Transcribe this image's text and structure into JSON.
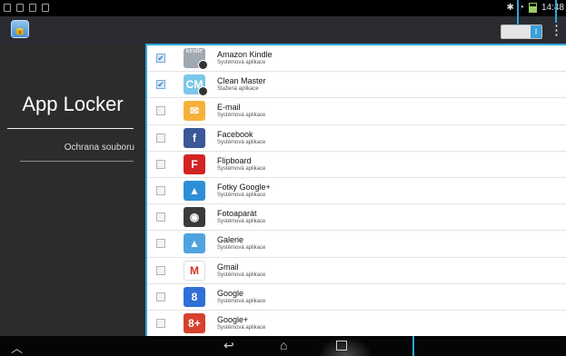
{
  "status": {
    "time": "14:48"
  },
  "left": {
    "title": "App Locker",
    "item": "Ochrana souboru"
  },
  "apps": [
    {
      "name": "Amazon Kindle",
      "sub": "Systémová aplikace",
      "checked": true,
      "icon": "kindle-icon",
      "color": "#a0a8b0",
      "glyph": "kindle",
      "locked": true
    },
    {
      "name": "Clean Master",
      "sub": "Stažená aplikace",
      "checked": true,
      "icon": "clean-master-icon",
      "color": "#7dc7e8",
      "glyph": "CM",
      "locked": true
    },
    {
      "name": "E-mail",
      "sub": "Systémová aplikace",
      "checked": false,
      "icon": "email-icon",
      "color": "#f6b13b",
      "glyph": "✉",
      "locked": false
    },
    {
      "name": "Facebook",
      "sub": "Systémová aplikace",
      "checked": false,
      "icon": "facebook-icon",
      "color": "#3b5998",
      "glyph": "f",
      "locked": false
    },
    {
      "name": "Flipboard",
      "sub": "Systémová aplikace",
      "checked": false,
      "icon": "flipboard-icon",
      "color": "#d32323",
      "glyph": "F",
      "locked": false
    },
    {
      "name": "Fotky Google+",
      "sub": "Systémová aplikace",
      "checked": false,
      "icon": "google-photos-icon",
      "color": "#2d8fd8",
      "glyph": "▲",
      "locked": false
    },
    {
      "name": "Fotoaparát",
      "sub": "Systémová aplikace",
      "checked": false,
      "icon": "camera-icon",
      "color": "#3a3a3a",
      "glyph": "◉",
      "locked": false
    },
    {
      "name": "Galerie",
      "sub": "Systémová aplikace",
      "checked": false,
      "icon": "gallery-icon",
      "color": "#4fa3e0",
      "glyph": "▲",
      "locked": false
    },
    {
      "name": "Gmail",
      "sub": "Systémová aplikace",
      "checked": false,
      "icon": "gmail-icon",
      "color": "#ffffff",
      "glyph": "M",
      "locked": false
    },
    {
      "name": "Google",
      "sub": "Systémová aplikace",
      "checked": false,
      "icon": "google-icon",
      "color": "#2f6fd6",
      "glyph": "8",
      "locked": false
    },
    {
      "name": "Google+",
      "sub": "Systémová aplikace",
      "checked": false,
      "icon": "google-plus-icon",
      "color": "#d7412f",
      "glyph": "8+",
      "locked": false
    }
  ],
  "colors": {
    "accent": "#2fa6dc",
    "actionbar": "#2a2c31"
  }
}
